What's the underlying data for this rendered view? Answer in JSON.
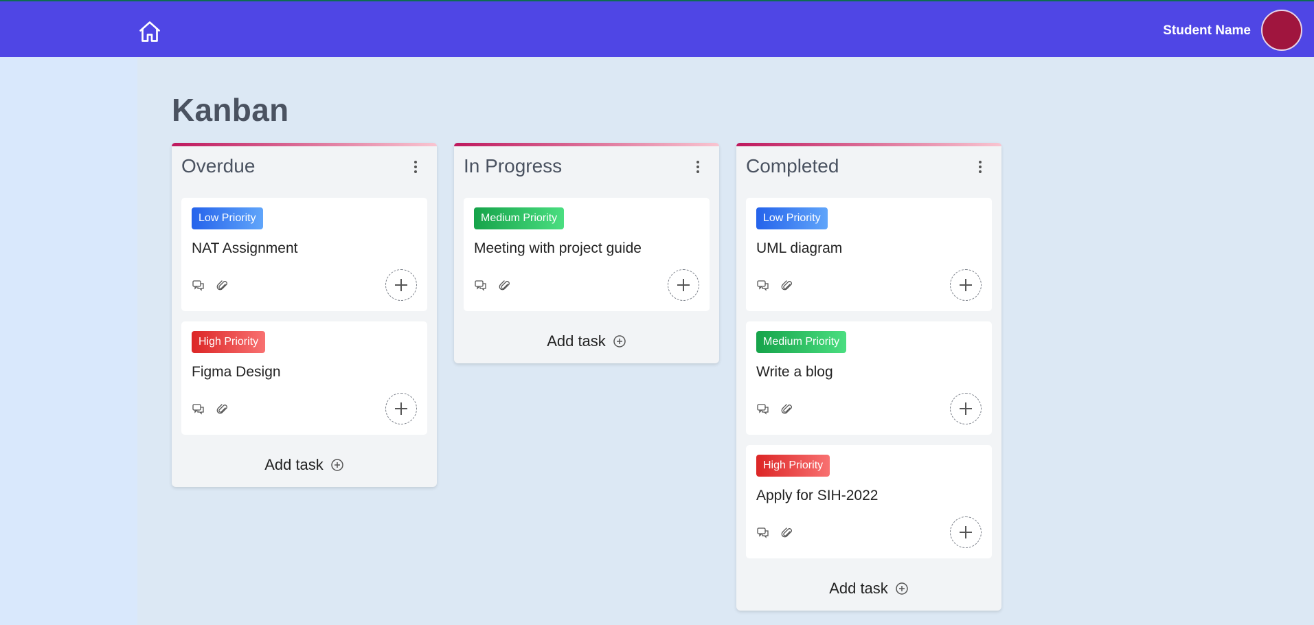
{
  "header": {
    "home_icon": "home-icon",
    "user_name": "Student Name",
    "avatar_color": "#a0153e"
  },
  "page": {
    "title": "Kanban"
  },
  "columns": [
    {
      "title": "Overdue",
      "add_task_label": "Add task",
      "cards": [
        {
          "priority": "Low Priority",
          "priority_level": "low",
          "title": "NAT Assignment"
        },
        {
          "priority": "High Priority",
          "priority_level": "high",
          "title": "Figma Design"
        }
      ]
    },
    {
      "title": "In Progress",
      "add_task_label": "Add task",
      "cards": [
        {
          "priority": "Medium Priority",
          "priority_level": "medium",
          "title": "Meeting with project guide"
        }
      ]
    },
    {
      "title": "Completed",
      "add_task_label": "Add task",
      "cards": [
        {
          "priority": "Low Priority",
          "priority_level": "low",
          "title": "UML diagram"
        },
        {
          "priority": "Medium Priority",
          "priority_level": "medium",
          "title": "Write a blog"
        },
        {
          "priority": "High Priority",
          "priority_level": "high",
          "title": "Apply for SIH-2022"
        }
      ]
    }
  ],
  "colors": {
    "topbar": "#4f46e5",
    "column_accent_start": "#be185d",
    "low": "#2563eb",
    "medium": "#16a34a",
    "high": "#dc2626"
  }
}
